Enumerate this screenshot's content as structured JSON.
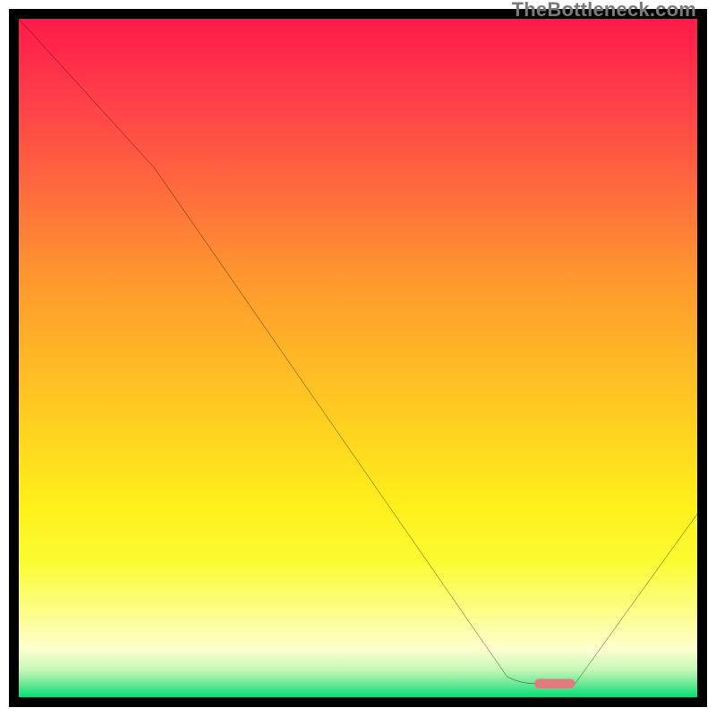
{
  "watermark": "TheBottleneck.com",
  "chart_data": {
    "type": "line",
    "title": "",
    "xlabel": "",
    "ylabel": "",
    "xlim": [
      0,
      100
    ],
    "ylim": [
      0,
      100
    ],
    "grid": false,
    "legend": false,
    "series": [
      {
        "name": "curve",
        "color": "#000000",
        "x": [
          0,
          20,
          72,
          76,
          82,
          100
        ],
        "values": [
          100,
          78,
          3,
          2,
          2,
          27
        ]
      }
    ],
    "marker": {
      "name": "optimum-bar",
      "color": "#e17b7f",
      "x_range": [
        76,
        82
      ],
      "y": 2,
      "thickness_pct": 1.4
    },
    "background_gradient": {
      "top": "#ff1a49",
      "middle": "#fff01b",
      "bottom": "#00df77"
    }
  }
}
